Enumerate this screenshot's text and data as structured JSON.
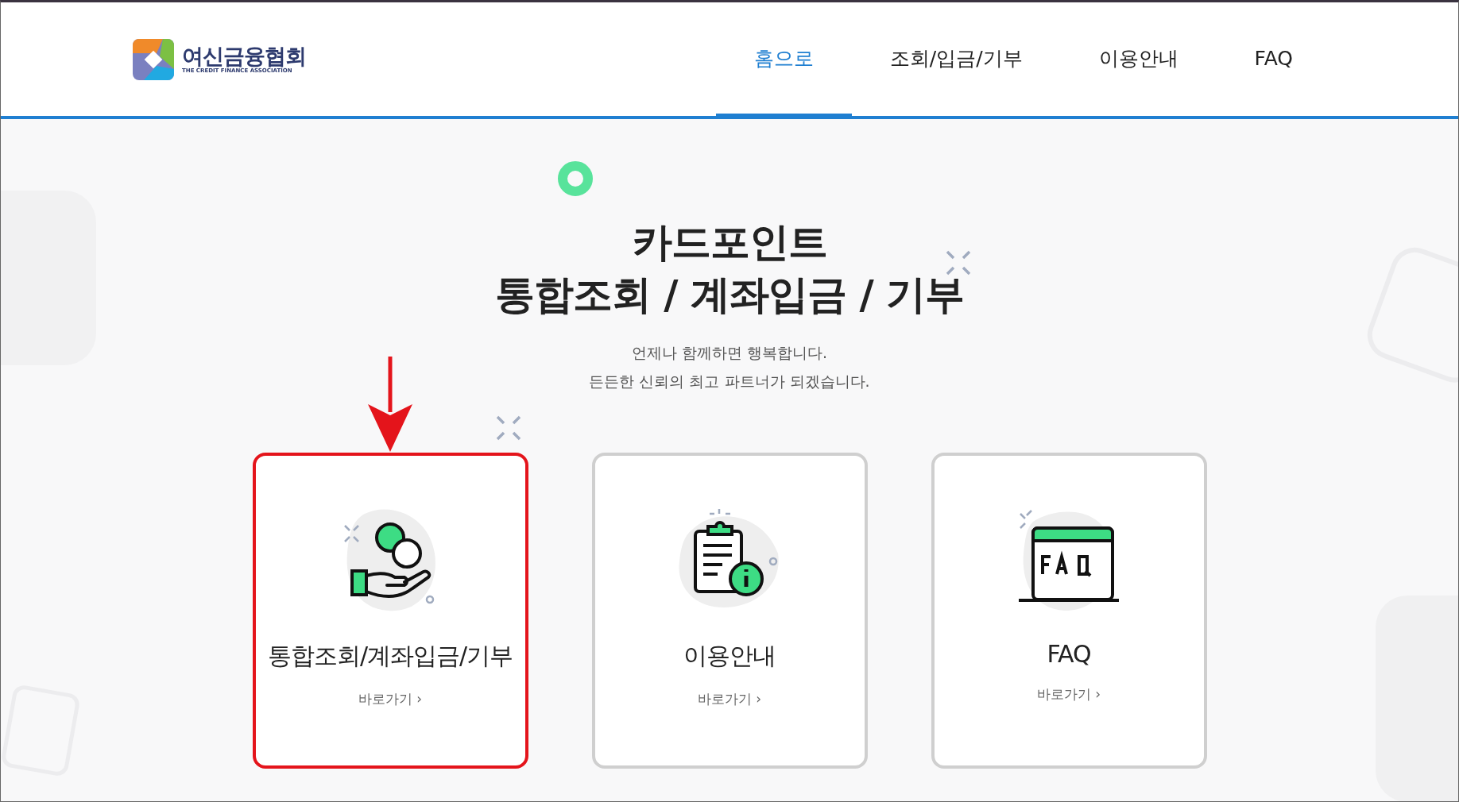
{
  "header": {
    "logo": {
      "name": "여신금융협회",
      "subtitle": "THE CREDIT FINANCE ASSOCIATION"
    },
    "nav": [
      {
        "label": "홈으로",
        "selected": true
      },
      {
        "label": "조회/입금/기부",
        "selected": false
      },
      {
        "label": "이용안내",
        "selected": false
      },
      {
        "label": "FAQ",
        "selected": false
      }
    ]
  },
  "hero": {
    "title_lines": [
      "카드포인트",
      "통합조회 / 계좌입금 / 기부"
    ],
    "subtitle_lines": [
      "언제나 함께하면 행복합니다.",
      "든든한 신뢰의 최고 파트너가 되겠습니다."
    ]
  },
  "cards": [
    {
      "kind": "coin",
      "title": "통합조회/계좌입금/기부",
      "link": "바로가기 ›",
      "highlighted": true
    },
    {
      "kind": "info",
      "title": "이용안내",
      "link": "바로가기 ›",
      "highlighted": false
    },
    {
      "kind": "faq",
      "title": "FAQ",
      "link": "바로가기 ›",
      "highlighted": false
    }
  ]
}
